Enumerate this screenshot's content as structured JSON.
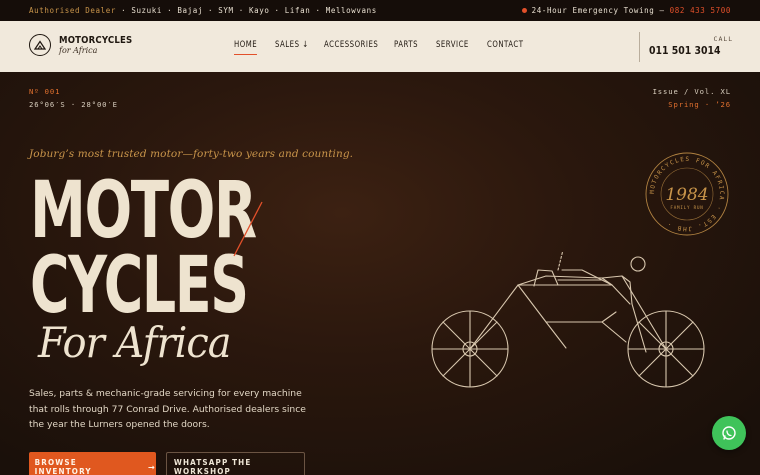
{
  "topbar": {
    "dealer_label": "Authorised Dealer",
    "brands": "· Suzuki · Bajaj · SYM · Kayo · Lifan · Mellowvans",
    "towing_text": "24-Hour Emergency Towing —",
    "towing_phone": "082 433 5700"
  },
  "brand": {
    "name": "MOTORCYCLES",
    "sub": "for Africa"
  },
  "nav": {
    "items": [
      "HOME",
      "SALES ↓",
      "ACCESSORIES",
      "PARTS",
      "SERVICE",
      "CONTACT"
    ],
    "call_label": "CALL",
    "call_number": "011 501 3014"
  },
  "hero": {
    "issue_no": "Nº 001",
    "coords": "26°06′S · 28°00′E",
    "issue_vol": "Issue / Vol. XL",
    "season": "Spring · ’26",
    "tagline": "Joburg’s most trusted motor—forty-two years and counting.",
    "headline_1": "MOTOR",
    "headline_2": "CYCLES",
    "headline_3": "For Africa",
    "description": "Sales, parts & mechanic-grade servicing for every machine that rolls through 77 Conrad Drive. Authorised dealers since the year the Lurners opened the doors.",
    "primary_button": "BROWSE INVENTORY",
    "primary_arrow": "→",
    "secondary_button": "WHATSAPP THE WORKSHOP",
    "stamp_text": "MOTORCYCLES FOR AFRICA · EST. JHB ·",
    "stamp_year": "1984",
    "stamp_sub": "FAMILY RUN"
  },
  "colors": {
    "accent": "#e2502a",
    "gold": "#c8944a",
    "cream": "#eee3cf",
    "whatsapp": "#3fc35a"
  },
  "icons": {
    "brand": "brand-mountain-icon",
    "whatsapp": "whatsapp-icon"
  }
}
